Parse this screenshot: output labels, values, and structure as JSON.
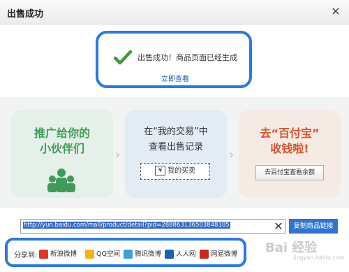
{
  "dialog": {
    "title": "出售成功",
    "close": "×"
  },
  "success": {
    "message": "出售成功！商品页面已经生成",
    "link": "立即查看"
  },
  "cards": {
    "promote": {
      "line1": "推广给你的",
      "line2": "小伙伴们",
      "icon": "people-icon"
    },
    "trade": {
      "line1": "在“我的交易”中",
      "line2": "查看出售记录",
      "button_icon": "¥",
      "button": "我的买卖"
    },
    "alipay": {
      "line1": "去“百付宝”",
      "line2": "收钱啦!",
      "button": "去百付宝查看余额"
    },
    "arrow": "›"
  },
  "link": {
    "url": "http://yun.baidu.com/mall/product/detail?pid=288863136503848105",
    "clear": "✕",
    "copy": "复制商品链接"
  },
  "share": {
    "label": "分享到:",
    "items": [
      {
        "name": "新浪微博",
        "color": "#e2362b"
      },
      {
        "name": "QQ空间",
        "color": "#f3b417"
      },
      {
        "name": "腾讯微博",
        "color": "#3aa0d8"
      },
      {
        "name": "人人网",
        "color": "#1d5fb4"
      },
      {
        "name": "网易微博",
        "color": "#c8281f"
      }
    ]
  },
  "watermark": {
    "text": "Bai 经验",
    "sub": "jingyan.baidu.com"
  }
}
